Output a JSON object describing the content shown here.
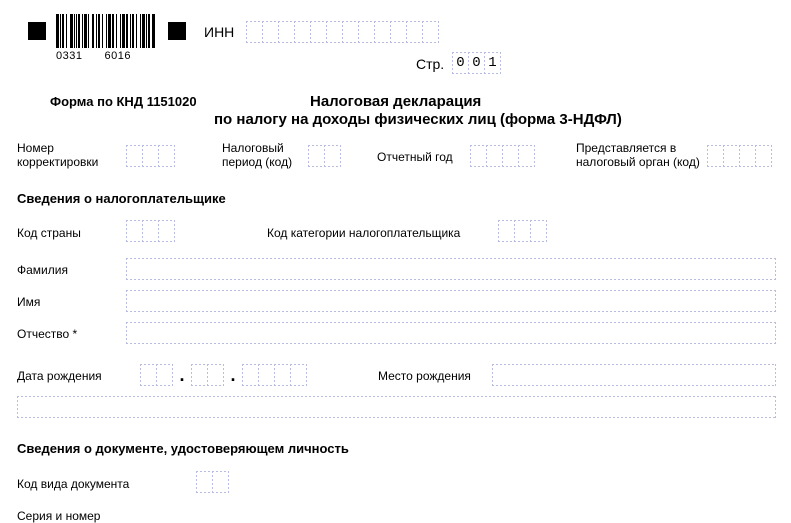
{
  "barcode": {
    "left": "0331",
    "right": "6016"
  },
  "hdr": {
    "inn_label": "ИНН",
    "page_label": "Стр.",
    "page_no": [
      "0",
      "0",
      "1"
    ],
    "form_code": "Форма по КНД 1151020",
    "title1": "Налоговая декларация",
    "title2": "по налогу на доходы физических лиц (форма 3-НДФЛ)"
  },
  "r1": {
    "corr_label": "Номер\nкорректировки",
    "tax_period_label": "Налоговый\nпериод (код)",
    "report_year_label": "Отчетный год",
    "auth_label": "Представляется в\nналоговый орган (код)"
  },
  "s1": {
    "heading": "Сведения о налогоплательщике",
    "country_label": "Код страны",
    "cat_label": "Код категории налогоплательщика",
    "surname_label": "Фамилия",
    "name_label": "Имя",
    "patronymic_label": "Отчество *",
    "dob_label": "Дата рождения",
    "pob_label": "Место рождения"
  },
  "s2": {
    "heading": "Сведения о документе, удостоверяющем личность",
    "doctype_label": "Код вида документа",
    "serial_label": "Серия и номер"
  }
}
